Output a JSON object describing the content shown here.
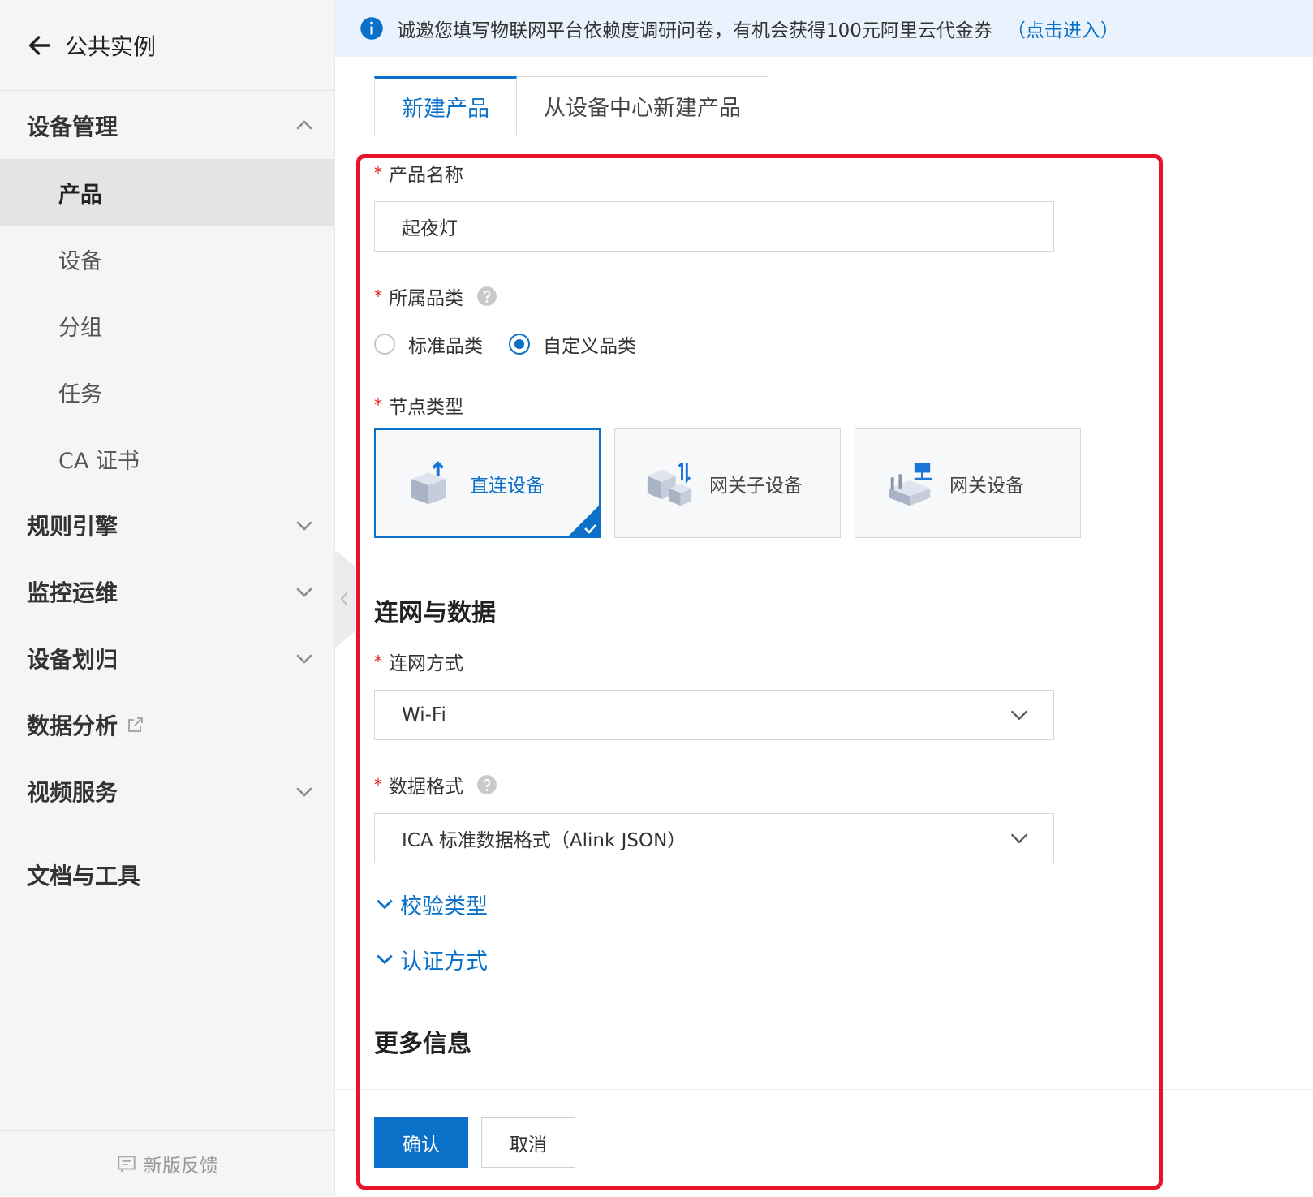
{
  "sidebar": {
    "back_title": "公共实例",
    "groups": {
      "device_mgmt": "设备管理",
      "rules_engine": "规则引擎",
      "monitoring": "监控运维",
      "device_assign": "设备划归",
      "data_analysis": "数据分析",
      "video_service": "视频服务",
      "docs_tools": "文档与工具"
    },
    "sub_items": [
      "产品",
      "设备",
      "分组",
      "任务",
      "CA 证书"
    ],
    "active_item": "产品",
    "feedback": "新版反馈"
  },
  "notice": {
    "text": "诚邀您填写物联网平台依赖度调研问卷，有机会获得100元阿里云代金券",
    "link": "（点击进入）"
  },
  "tabs": [
    "新建产品",
    "从设备中心新建产品"
  ],
  "form": {
    "product_name": {
      "label": "产品名称",
      "value": "起夜灯"
    },
    "category": {
      "label": "所属品类",
      "options": [
        "标准品类",
        "自定义品类"
      ],
      "selected": "自定义品类"
    },
    "node_type": {
      "label": "节点类型",
      "options": [
        "直连设备",
        "网关子设备",
        "网关设备"
      ],
      "selected": "直连设备"
    },
    "network_section_title": "连网与数据",
    "network_method": {
      "label": "连网方式",
      "value": "Wi-Fi"
    },
    "data_format": {
      "label": "数据格式",
      "value": "ICA 标准数据格式（Alink JSON）"
    },
    "verify_type": "校验类型",
    "auth_method": "认证方式",
    "more_info_title": "更多信息"
  },
  "buttons": {
    "confirm": "确认",
    "cancel": "取消"
  },
  "colors": {
    "accent": "#0a70c8",
    "highlight": "#e8142c",
    "required": "#e02020"
  }
}
